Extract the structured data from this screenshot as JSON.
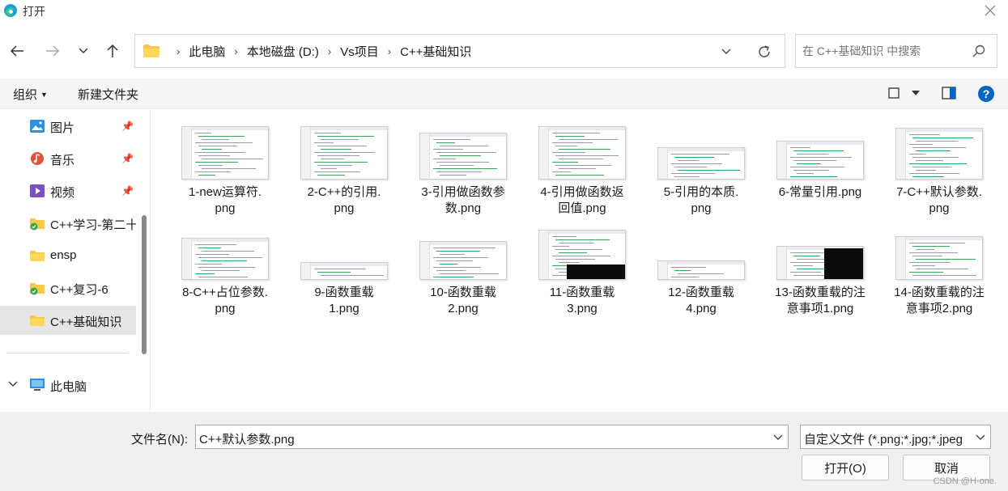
{
  "window": {
    "title": "打开"
  },
  "address": {
    "crumbs": [
      "此电脑",
      "本地磁盘 (D:)",
      "Vs项目",
      "C++基础知识"
    ]
  },
  "search": {
    "placeholder": "在 C++基础知识 中搜索"
  },
  "toolbar": {
    "organize": "组织",
    "new_folder": "新建文件夹"
  },
  "sidebar": {
    "items": [
      {
        "label": "图片",
        "icon": "pictures-icon",
        "pinned": true
      },
      {
        "label": "音乐",
        "icon": "music-icon",
        "pinned": true
      },
      {
        "label": "视频",
        "icon": "video-icon",
        "pinned": true
      },
      {
        "label": "C++学习-第二十",
        "icon": "folder-synced-icon",
        "pinned": false
      },
      {
        "label": "ensp",
        "icon": "folder-icon",
        "pinned": false
      },
      {
        "label": "C++复习-6",
        "icon": "folder-synced-icon",
        "pinned": false
      },
      {
        "label": "C++基础知识",
        "icon": "folder-icon",
        "pinned": false,
        "selected": true
      }
    ],
    "this_pc": "此电脑"
  },
  "files": [
    {
      "name": "1-new运算符.png"
    },
    {
      "name": "2-C++的引用.png"
    },
    {
      "name": "3-引用做函数参数.png"
    },
    {
      "name": "4-引用做函数返回值.png"
    },
    {
      "name": "5-引用的本质.png"
    },
    {
      "name": "6-常量引用.png"
    },
    {
      "name": "7-C++默认参数.png"
    },
    {
      "name": "8-C++占位参数.png"
    },
    {
      "name": "9-函数重载1.png"
    },
    {
      "name": "10-函数重载2.png"
    },
    {
      "name": "11-函数重载3.png"
    },
    {
      "name": "12-函数重载4.png"
    },
    {
      "name": "13-函数重载的注意事项1.png"
    },
    {
      "name": "14-函数重载的注意事项2.png"
    }
  ],
  "file_names_display": [
    [
      "1-new运算符.",
      "png"
    ],
    [
      "2-C++的引用.",
      "png"
    ],
    [
      "3-引用做函数参",
      "数.png"
    ],
    [
      "4-引用做函数返",
      "回值.png"
    ],
    [
      "5-引用的本质.",
      "png"
    ],
    [
      "6-常量引用.png",
      ""
    ],
    [
      "7-C++默认参数.",
      "png"
    ],
    [
      "8-C++占位参数.",
      "png"
    ],
    [
      "9-函数重载",
      "1.png"
    ],
    [
      "10-函数重载",
      "2.png"
    ],
    [
      "11-函数重载",
      "3.png"
    ],
    [
      "12-函数重载",
      "4.png"
    ],
    [
      "13-函数重载的注",
      "意事项1.png"
    ],
    [
      "14-函数重载的注",
      "意事项2.png"
    ]
  ],
  "bottom": {
    "filename_label": "文件名(N):",
    "filename_value": "C++默认参数.png",
    "filetype": "自定义文件 (*.png;*.jpg;*.jpeg",
    "open_button": "打开(O)",
    "cancel_button": "取消",
    "watermark": "CSDN @H-one."
  },
  "colors": {
    "accent": "#0067c0",
    "selected": "#e5e5e5",
    "folder": "#f7c948"
  }
}
